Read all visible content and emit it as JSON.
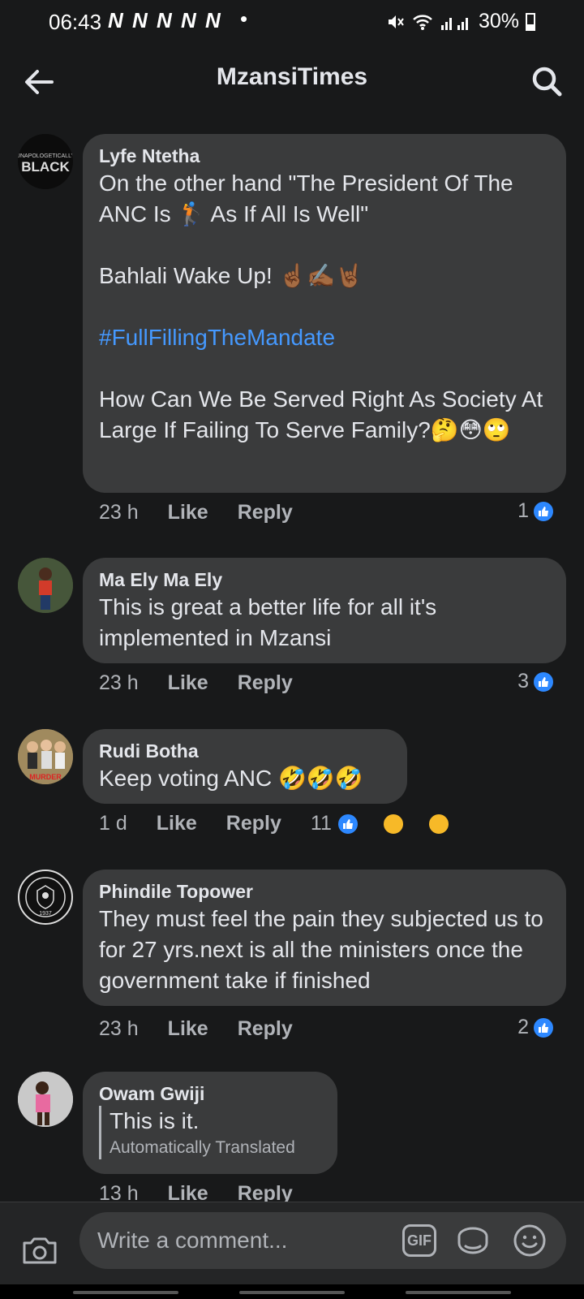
{
  "status_bar": {
    "time": "06:43",
    "notifications": "N N N N N",
    "dot": "•",
    "battery": "30%"
  },
  "header": {
    "title": "MzansiTimes",
    "back_icon": "arrow-left-icon",
    "search_icon": "search-icon"
  },
  "comments": [
    {
      "author": "Lyfe Ntetha",
      "avatar_text": "UNAPOLOGETICALLY BLACK",
      "line1": "On the other hand \"The President Of The ANC Is 🏌 As If All Is Well\"",
      "line2": "Bahlali Wake Up! ☝🏾✍🏾🤘🏾",
      "hashtag": "#FullFillingTheMandate",
      "line3": "How Can We Be Served Right As Society At Large If Failing To Serve Family?🤔😳🙄",
      "time": "23 h",
      "like": "Like",
      "reply": "Reply",
      "reactions": "1"
    },
    {
      "author": "Ma Ely Ma Ely",
      "text": "This is great a better life for all it's implemented in Mzansi",
      "time": "23 h",
      "like": "Like",
      "reply": "Reply",
      "reactions": "3"
    },
    {
      "author": "Rudi Botha",
      "avatar_text": "MURDER",
      "text": "Keep voting ANC 🤣🤣🤣",
      "time": "1 d",
      "like": "Like",
      "reply": "Reply",
      "reactions": "11"
    },
    {
      "author": "Phindile Topower",
      "avatar_text": "1937",
      "text": "They must feel the pain they subjected us to for 27 yrs.next is all the ministers once the government take if finished",
      "time": "23 h",
      "like": "Like",
      "reply": "Reply",
      "reactions": "2"
    },
    {
      "author": "Owam Gwiji",
      "text": "This is it.",
      "translated": "Automatically Translated",
      "time": "13 h",
      "like": "Like",
      "reply": "Reply"
    }
  ],
  "composer": {
    "placeholder": "Write a comment...",
    "gif_label": "GIF",
    "camera_icon": "camera-icon",
    "sticker_icon": "sticker-icon",
    "emoji_icon": "emoji-icon"
  },
  "colors": {
    "background": "#18191a",
    "bubble": "#3a3b3c",
    "hashtag": "#4599ff",
    "like_blue": "#2d88ff"
  }
}
